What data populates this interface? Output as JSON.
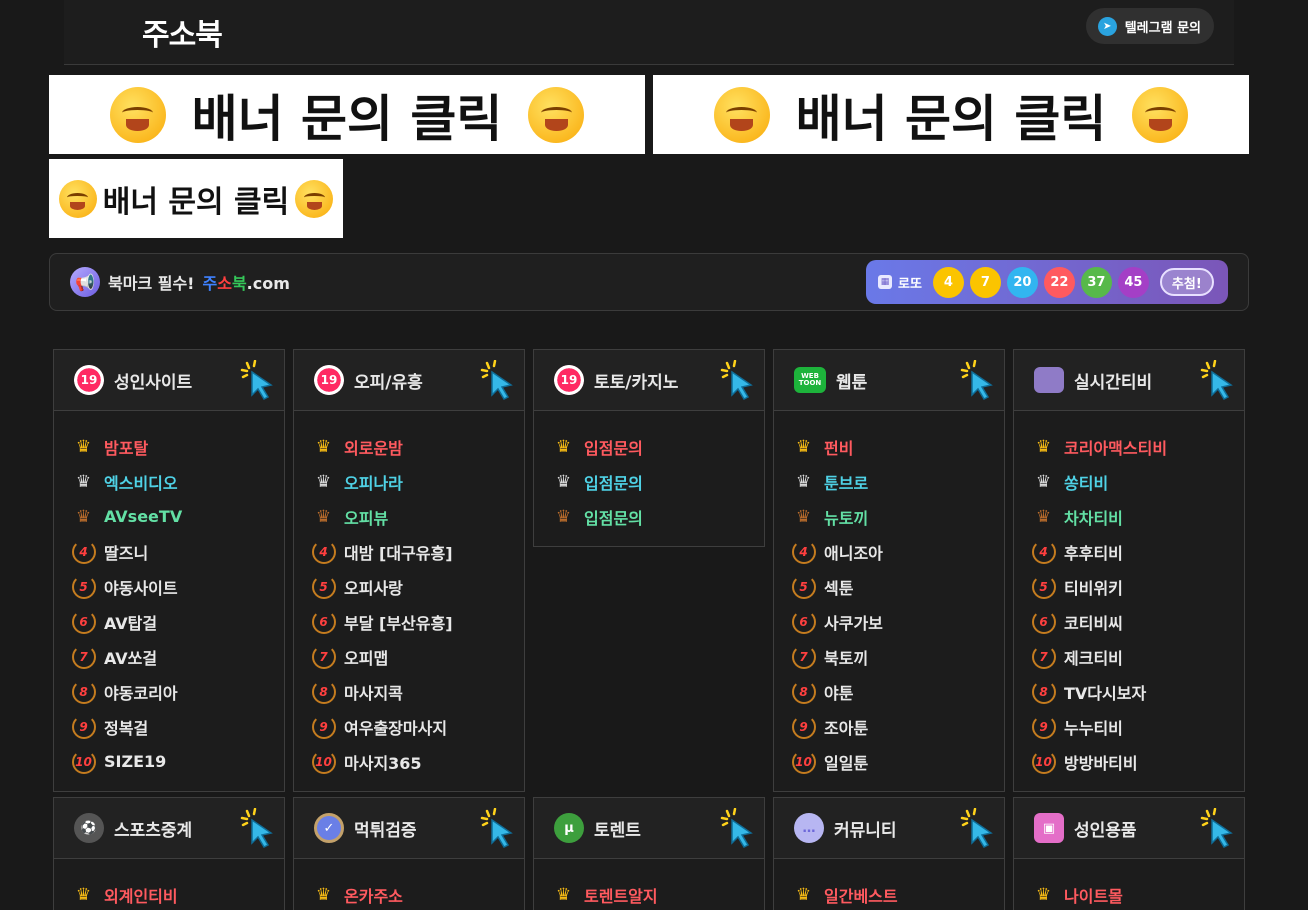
{
  "header": {
    "logo": "주소북",
    "telegram_label": "텔레그램 문의"
  },
  "banners": [
    {
      "text": "배너 문의 클릭"
    },
    {
      "text": "배너 문의 클릭"
    },
    {
      "text": "배너 문의 클릭"
    }
  ],
  "notice": {
    "prefix": "북마크 필수!",
    "brand_a": "주",
    "brand_b": "소",
    "brand_c": "북",
    "suffix": ".com"
  },
  "lotto": {
    "label": "로또",
    "numbers": [
      "4",
      "7",
      "20",
      "22",
      "37",
      "45"
    ],
    "ball_colors": [
      "#fbc400",
      "#fbc400",
      "#32b5f0",
      "#ff5a5f",
      "#57b94a",
      "#a43fc6"
    ],
    "draw_label": "추첨!"
  },
  "rank_colors": {
    "top1": "#ff5a5f",
    "top2": "#4fd2e6",
    "top3": "#63e0a5",
    "other": "#e8e8e8"
  },
  "categories": [
    {
      "title": "성인사이트",
      "icon": "19-icon",
      "items": [
        "밤포탈",
        "엑스비디오",
        "AVseeTV",
        "딸즈니",
        "야동사이트",
        "AV탑걸",
        "AV쏘걸",
        "야동코리아",
        "정복걸",
        "SIZE19"
      ]
    },
    {
      "title": "오피/유흥",
      "icon": "19-icon",
      "items": [
        "외로운밤",
        "오피나라",
        "오피뷰",
        "대밤 [대구유흥]",
        "오피사랑",
        "부달 [부산유흥]",
        "오피맵",
        "마사지콕",
        "여우출장마사지",
        "마사지365"
      ]
    },
    {
      "title": "토토/카지노",
      "icon": "19-icon",
      "items": [
        "입점문의",
        "입점문의",
        "입점문의"
      ]
    },
    {
      "title": "웹툰",
      "icon": "webtoon-icon",
      "items": [
        "펀비",
        "툰브로",
        "뉴토끼",
        "애니조아",
        "섹툰",
        "사쿠가보",
        "북토끼",
        "야툰",
        "조아툰",
        "일일툰"
      ]
    },
    {
      "title": "실시간티비",
      "icon": "tv-icon",
      "items": [
        "코리아맥스티비",
        "쏭티비",
        "차차티비",
        "후후티비",
        "티비위키",
        "코티비씨",
        "제크티비",
        "TV다시보자",
        "누누티비",
        "방방바티비"
      ]
    },
    {
      "title": "스포츠중계",
      "icon": "sports-icon",
      "items": [
        "외계인티비"
      ]
    },
    {
      "title": "먹튀검증",
      "icon": "verify-badge-icon",
      "items": [
        "온카주소"
      ]
    },
    {
      "title": "토렌트",
      "icon": "torrent-icon",
      "items": [
        "토렌트알지"
      ]
    },
    {
      "title": "커뮤니티",
      "icon": "chat-bubble-icon",
      "items": [
        "일간베스트"
      ]
    },
    {
      "title": "성인용품",
      "icon": "gift-box-icon",
      "items": [
        "나이트몰"
      ]
    }
  ]
}
